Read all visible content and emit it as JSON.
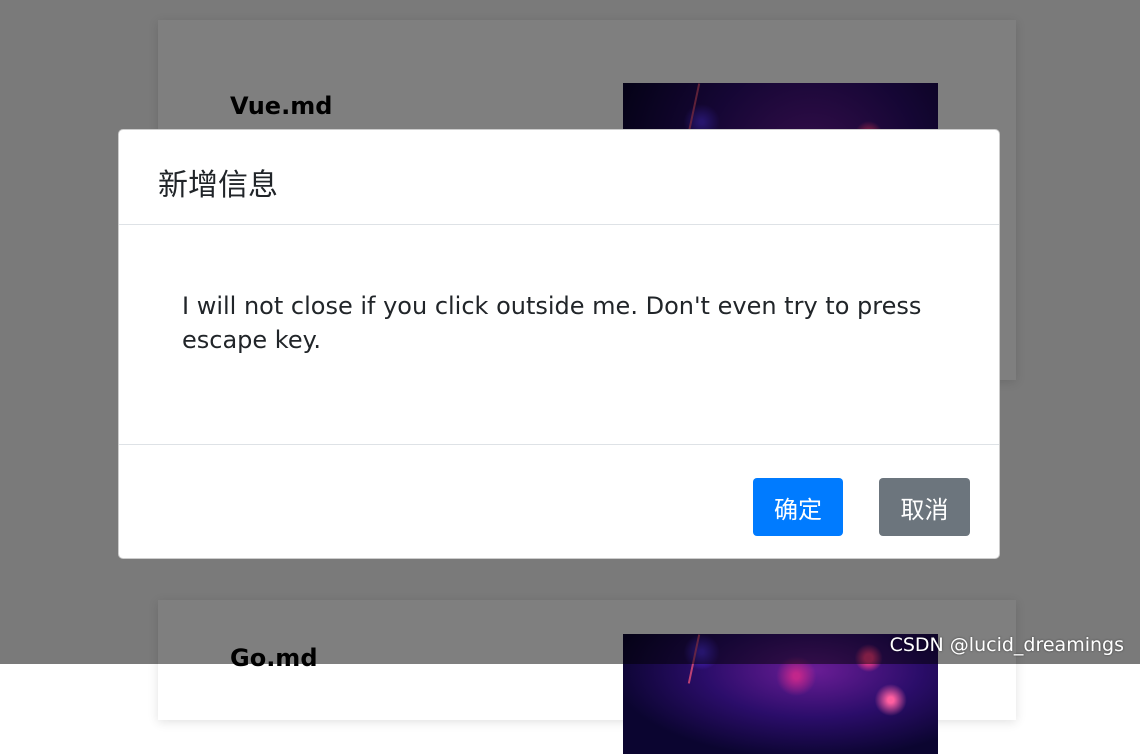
{
  "background": {
    "cards": [
      {
        "title": "Vue.md",
        "thumbnail": "nebula-image"
      },
      {
        "title": "Go.md",
        "thumbnail": "nebula-image"
      }
    ]
  },
  "modal": {
    "title": "新增信息",
    "body_text": "I will not close if you click outside me. Don't even try to press escape key.",
    "confirm_label": "确定",
    "cancel_label": "取消"
  },
  "colors": {
    "primary": "#007bff",
    "secondary": "#6c757d",
    "backdrop": "rgba(0,0,0,0.5)"
  },
  "watermark": "CSDN @lucid_dreamings"
}
